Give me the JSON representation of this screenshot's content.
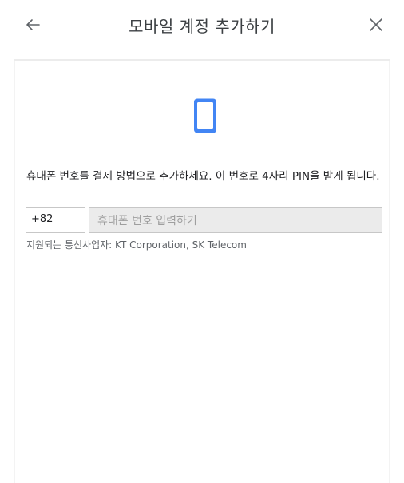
{
  "header": {
    "title": "모바일 계정 추가하기",
    "back_icon": "arrow-left-icon",
    "close_icon": "close-icon"
  },
  "illustration": {
    "icon": "smartphone-icon",
    "color": "#4285f4"
  },
  "description": "휴대폰 번호를 결제 방법으로 추가하세요. 이 번호로 4자리 PIN을 받게 됩니다.",
  "form": {
    "country_code": "+82",
    "phone_placeholder": "휴대폰 번호 입력하기"
  },
  "carriers_text": "지원되는 통신사업자: KT Corporation, SK Telecom"
}
